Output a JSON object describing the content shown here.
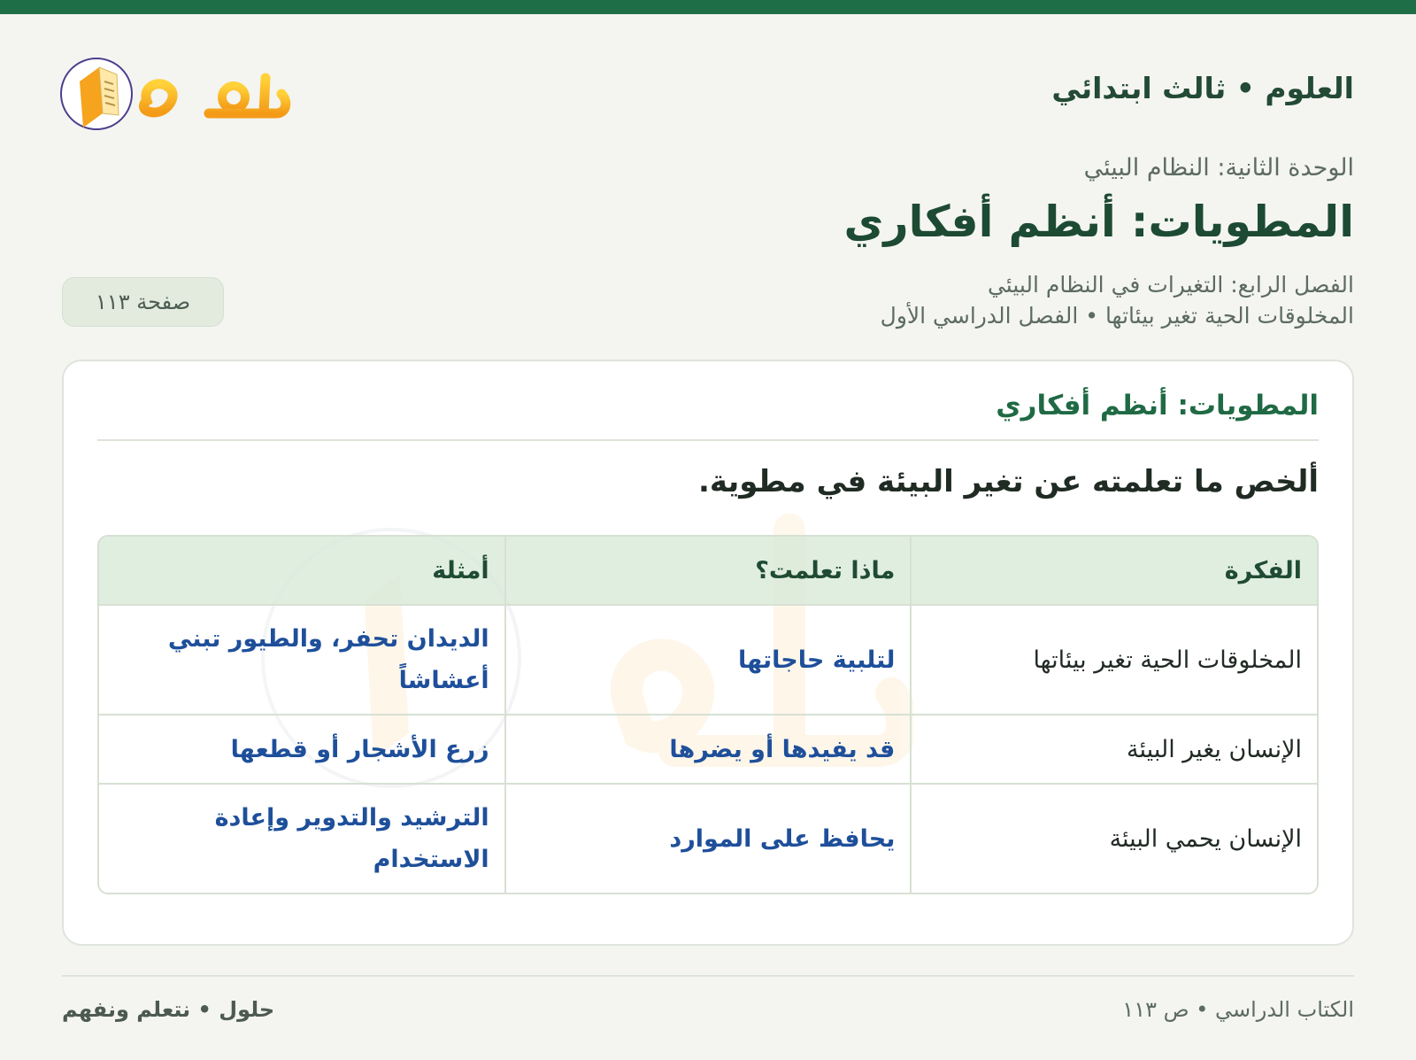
{
  "header": {
    "title": "العلوم • ثالث ابتدائي",
    "logo_text": "حلول"
  },
  "lesson": {
    "unit": "الوحدة الثانية: النظام البيئي",
    "title": "المطويات: أنظم أفكاري",
    "chapter": "الفصل الرابع: التغيرات في النظام البيئي",
    "topic": "المخلوقات الحية تغير بيئاتها • الفصل الدراسي الأول",
    "page_badge": "صفحة ١١٣"
  },
  "card": {
    "title": "المطويات: أنظم أفكاري",
    "instruction": "ألخص ما تعلمته عن تغير البيئة في مطوية.",
    "table": {
      "headers": [
        "الفكرة",
        "ماذا تعلمت؟",
        "أمثلة"
      ],
      "rows": [
        [
          "المخلوقات الحية تغير بيئاتها",
          "لتلبية حاجاتها",
          "الديدان تحفر، والطيور تبني أعشاشاً"
        ],
        [
          "الإنسان يغير البيئة",
          "قد يفيدها أو يضرها",
          "زرع الأشجار أو قطعها"
        ],
        [
          "الإنسان يحمي البيئة",
          "يحافظ على الموارد",
          "الترشيد والتدوير وإعادة الاستخدام"
        ]
      ]
    }
  },
  "footer": {
    "right": "الكتاب الدراسي • ص ١١٣",
    "left": "حلول • نتعلم ونفهم"
  },
  "colors": {
    "brand_green": "#1e6e47",
    "answer_blue": "#1e4f9a",
    "logo_orange": "#f5a51c"
  }
}
